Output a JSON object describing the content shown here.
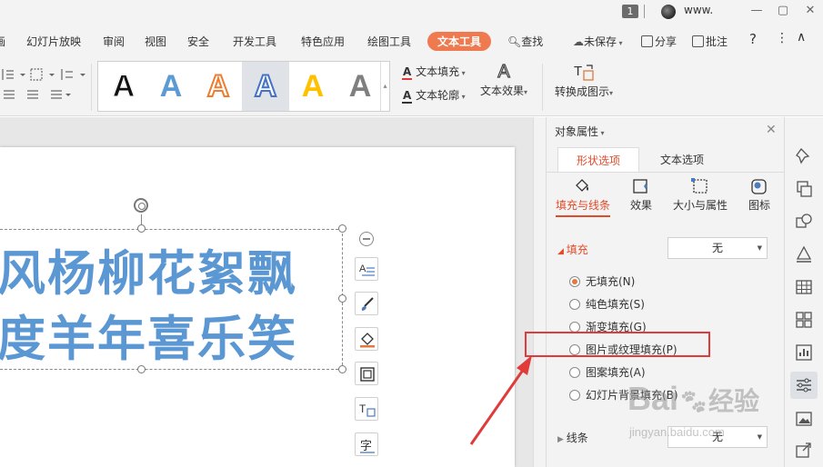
{
  "titlebar": {
    "badge": "1",
    "user": "www.",
    "buttons": [
      "—",
      "▢",
      "✕"
    ]
  },
  "menu": {
    "tabs": [
      "画",
      "幻灯片放映",
      "审阅",
      "视图",
      "安全",
      "开发工具",
      "特色应用",
      "绘图工具",
      "文本工具"
    ],
    "active_tab": "文本工具",
    "search": "查找",
    "unsaved": "未保存",
    "share": "分享",
    "comment": "批注",
    "help": "?",
    "more": "⋮",
    "collapse": "∧"
  },
  "ribbon": {
    "text_fill": "文本填充",
    "text_outline": "文本轮廓",
    "text_effect": "文本效果",
    "convert": "转换成图示",
    "styles": [
      {
        "glyph": "A",
        "color": "#111111"
      },
      {
        "glyph": "A",
        "color": "#5b9bd5"
      },
      {
        "glyph": "A",
        "color": "#ed7d31"
      },
      {
        "glyph": "A",
        "color": "#4472c4"
      },
      {
        "glyph": "A",
        "color": "#ffc000"
      },
      {
        "glyph": "A",
        "color": "#7f7f7f"
      }
    ]
  },
  "slide": {
    "line1": "风杨柳花絮飘",
    "line2": "度羊年喜乐笑",
    "text_color": "#5a97d3"
  },
  "pane": {
    "title": "对象属性",
    "tabs": [
      "形状选项",
      "文本选项"
    ],
    "subtabs": [
      "填充与线条",
      "效果",
      "大小与属性",
      "图标"
    ],
    "fill_label": "填充",
    "fill_value": "无",
    "options": [
      "无填充(N)",
      "纯色填充(S)",
      "渐变填充(G)",
      "图片或纹理填充(P)",
      "图案填充(A)",
      "幻灯片背景填充(B)"
    ],
    "line_label": "线条",
    "line_value": "无"
  },
  "watermark": {
    "brand": "Bai",
    "brand2": "经验",
    "url": "jingyan.baidu.com"
  },
  "colors": {
    "accent": "#ef7a4f",
    "highlight": "#e13a3a",
    "active_text": "#e04b2b"
  }
}
